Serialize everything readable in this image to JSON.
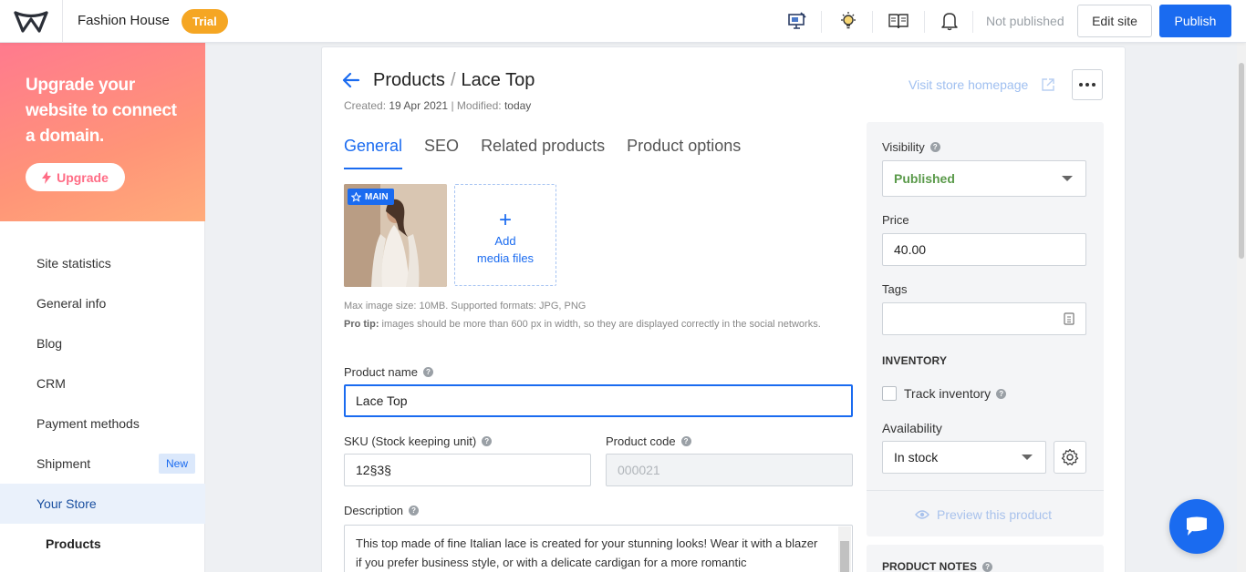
{
  "topbar": {
    "site_name": "Fashion House",
    "trial_label": "Trial",
    "status": "Not published",
    "edit_site_label": "Edit site",
    "publish_label": "Publish",
    "icons": [
      "monitor-edit-icon",
      "lightbulb-icon",
      "book-icon",
      "bell-icon"
    ]
  },
  "sidebar": {
    "upgrade_text": "Upgrade your website to connect a domain.",
    "upgrade_button": "Upgrade",
    "items": [
      {
        "label": "Site statistics"
      },
      {
        "label": "General info"
      },
      {
        "label": "Blog"
      },
      {
        "label": "CRM"
      },
      {
        "label": "Payment methods"
      },
      {
        "label": "Shipment",
        "badge": "New"
      },
      {
        "label": "Your Store",
        "active": true
      },
      {
        "label": "Products",
        "sub": true
      }
    ]
  },
  "product": {
    "breadcrumb_parent": "Products",
    "breadcrumb_sep": "/",
    "title": "Lace Top",
    "created_label": "Created:",
    "created_value": "19 Apr 2021",
    "modified_label": "Modified:",
    "modified_value": "today",
    "visit_store_label": "Visit store homepage",
    "tabs": [
      "General",
      "SEO",
      "Related products",
      "Product options"
    ],
    "active_tab": "General",
    "main_badge": "MAIN",
    "add_media_line1": "Add",
    "add_media_line2": "media files",
    "hint_line1": "Max image size: 10MB. Supported formats: JPG, PNG",
    "hint_protip_label": "Pro tip:",
    "hint_protip_text": " images should be more than 600 px in width, so they are displayed correctly in the social networks.",
    "name_label": "Product name",
    "name_value": "Lace Top",
    "sku_label": "SKU (Stock keeping unit)",
    "sku_value": "12§3§",
    "code_label": "Product code",
    "code_value": "000021",
    "description_label": "Description",
    "description_value": "This top made of fine Italian lace is created for your stunning looks! Wear it with a blazer if you prefer business style, or with a delicate cardigan for a more romantic"
  },
  "settings": {
    "visibility_label": "Visibility",
    "visibility_value": "Published",
    "price_label": "Price",
    "price_value": "40.00",
    "tags_label": "Tags",
    "inventory_title": "INVENTORY",
    "track_inventory_label": "Track inventory",
    "availability_label": "Availability",
    "availability_value": "In stock",
    "preview_label": "Preview this product",
    "notes_title": "PRODUCT NOTES"
  },
  "colors": {
    "accent": "#1a6bf0",
    "trial": "#f5a623",
    "published": "#5a9a4a"
  }
}
